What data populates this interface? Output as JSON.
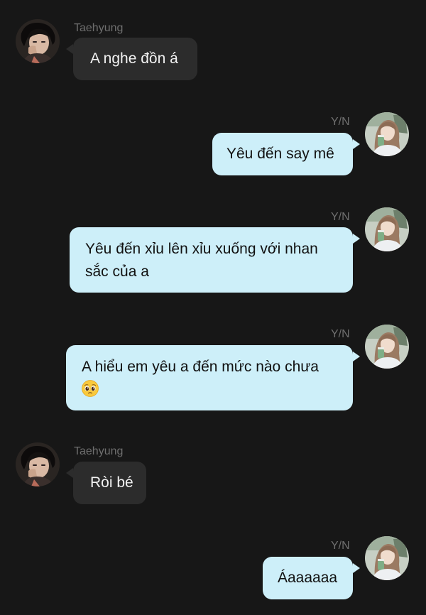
{
  "colors": {
    "background": "#171717",
    "received_bubble": "#2c2c2c",
    "sent_bubble": "#cdeff9",
    "sender_name": "#6f6f6f"
  },
  "messages": [
    {
      "sender": "Taehyung",
      "side": "left",
      "lines": [
        "A nghe đồn á"
      ],
      "avatar_icon": "boy-avatar-icon"
    },
    {
      "sender": "Y/N",
      "side": "right",
      "lines": [
        "Yêu đến say mê"
      ],
      "avatar_icon": "girl-avatar-icon"
    },
    {
      "sender": "Y/N",
      "side": "right",
      "lines": [
        "Yêu đến xỉu lên xỉu xuống với nhan",
        "sắc của a"
      ],
      "avatar_icon": "girl-avatar-icon"
    },
    {
      "sender": "Y/N",
      "side": "right",
      "lines": [
        "A hiểu em yêu a đến mức nào chưa"
      ],
      "emoji": "pleading-face-emoji",
      "avatar_icon": "girl-avatar-icon"
    },
    {
      "sender": "Taehyung",
      "side": "left",
      "lines": [
        "Ròi bé"
      ],
      "avatar_icon": "boy-avatar-icon"
    },
    {
      "sender": "Y/N",
      "side": "right",
      "lines": [
        "Áaaaaaa"
      ],
      "avatar_icon": "girl-avatar-icon"
    }
  ]
}
